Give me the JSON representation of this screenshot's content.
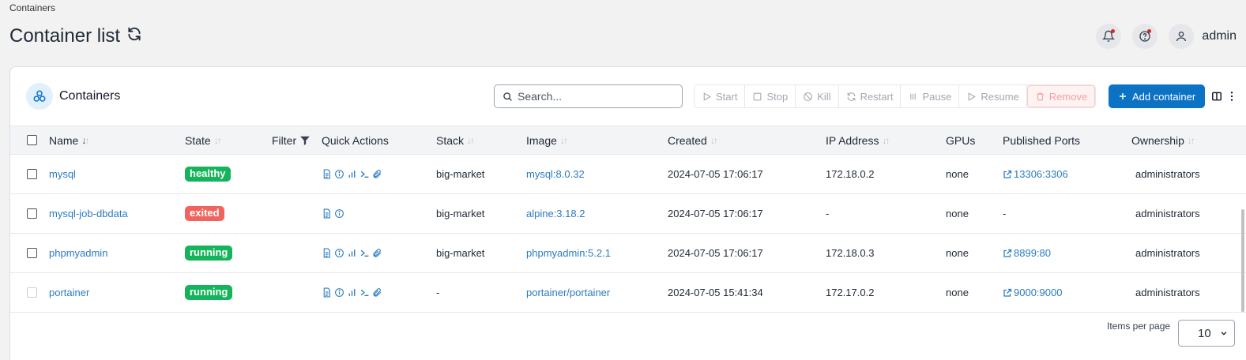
{
  "breadcrumb": "Containers",
  "page_title": "Container list",
  "user": "admin",
  "panel": {
    "title": "Containers",
    "search_placeholder": "Search...",
    "buttons": {
      "start": "Start",
      "stop": "Stop",
      "kill": "Kill",
      "restart": "Restart",
      "pause": "Pause",
      "resume": "Resume",
      "remove": "Remove",
      "add": "Add container"
    }
  },
  "columns": {
    "name": "Name",
    "state": "State",
    "filter": "Filter",
    "quick_actions": "Quick Actions",
    "stack": "Stack",
    "image": "Image",
    "created": "Created",
    "ip": "IP Address",
    "gpus": "GPUs",
    "ports": "Published Ports",
    "ownership": "Ownership"
  },
  "rows": [
    {
      "name": "mysql",
      "state": "healthy",
      "state_color": "#15b45b",
      "actions": 5,
      "stack": "big-market",
      "image": "mysql:8.0.32",
      "created": "2024-07-05 17:06:17",
      "ip": "172.18.0.2",
      "gpus": "none",
      "port": "13306:3306",
      "port_link": true,
      "ownership": "administrators"
    },
    {
      "name": "mysql-job-dbdata",
      "state": "exited",
      "state_color": "#f0645f",
      "actions": 2,
      "stack": "big-market",
      "image": "alpine:3.18.2",
      "created": "2024-07-05 17:06:17",
      "ip": "-",
      "gpus": "none",
      "port": "-",
      "port_link": false,
      "ownership": "administrators"
    },
    {
      "name": "phpmyadmin",
      "state": "running",
      "state_color": "#15b45b",
      "actions": 5,
      "stack": "big-market",
      "image": "phpmyadmin:5.2.1",
      "created": "2024-07-05 17:06:17",
      "ip": "172.18.0.3",
      "gpus": "none",
      "port": "8899:80",
      "port_link": true,
      "ownership": "administrators"
    },
    {
      "name": "portainer",
      "state": "running",
      "state_color": "#15b45b",
      "actions": 5,
      "stack": "-",
      "image": "portainer/portainer",
      "created": "2024-07-05 15:41:34",
      "ip": "172.17.0.2",
      "gpus": "none",
      "port": "9000:9000",
      "port_link": true,
      "ownership": "administrators"
    }
  ],
  "pagination": {
    "label": "Items per page",
    "value": "10"
  },
  "colors": {
    "accent": "#0b72c4",
    "link": "#2b7bc0",
    "healthy": "#15b45b",
    "exited": "#f0645f"
  }
}
